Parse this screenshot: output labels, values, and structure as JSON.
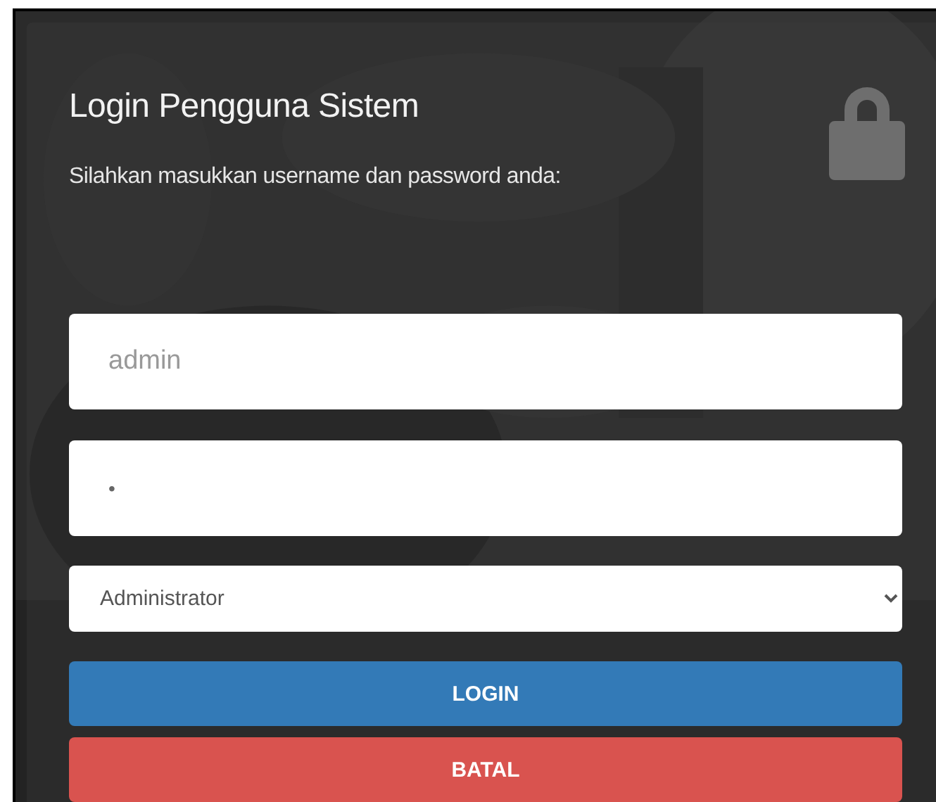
{
  "title": "Login Pengguna Sistem",
  "subtitle": "Silahkan masukkan username dan password anda:",
  "username": {
    "placeholder": "admin"
  },
  "password": {
    "value": "•"
  },
  "role": {
    "value": "Administrator"
  },
  "buttons": [
    {
      "label": "LOGIN",
      "kind": "primary"
    },
    {
      "label": "BATAL",
      "kind": "danger"
    }
  ]
}
